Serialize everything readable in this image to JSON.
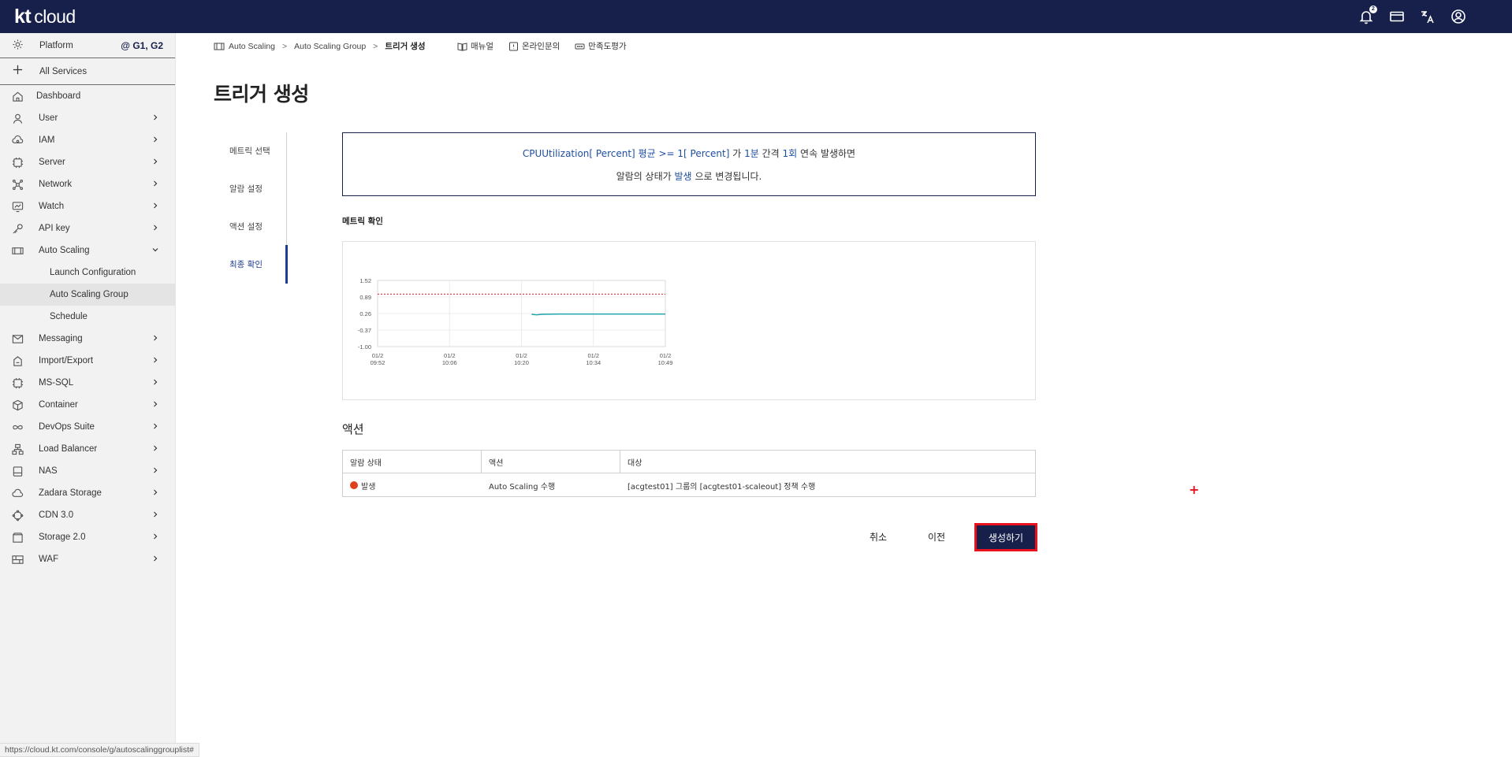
{
  "app": {
    "logo_kt": "kt",
    "logo_cloud": "cloud",
    "notification_count": "2"
  },
  "topbar": {
    "icons": [
      "bell-icon",
      "card-icon",
      "language-icon",
      "user-icon"
    ]
  },
  "sidebar": {
    "platform_label": "Platform",
    "region": "@ G1, G2",
    "all_services": "All Services",
    "dashboard": "Dashboard",
    "items": [
      {
        "label": "User"
      },
      {
        "label": "IAM"
      },
      {
        "label": "Server"
      },
      {
        "label": "Network"
      },
      {
        "label": "Watch"
      },
      {
        "label": "API key"
      },
      {
        "label": "Auto Scaling"
      }
    ],
    "sub_items": [
      {
        "label": "Launch Configuration"
      },
      {
        "label": "Auto Scaling Group"
      },
      {
        "label": "Schedule"
      }
    ],
    "items2": [
      {
        "label": "Messaging"
      },
      {
        "label": "Import/Export"
      },
      {
        "label": "MS-SQL"
      },
      {
        "label": "Container"
      },
      {
        "label": "DevOps Suite"
      },
      {
        "label": "Load Balancer"
      },
      {
        "label": "NAS"
      },
      {
        "label": "Zadara Storage"
      },
      {
        "label": "CDN 3.0"
      },
      {
        "label": "Storage 2.0"
      },
      {
        "label": "WAF"
      }
    ]
  },
  "statusbar": {
    "url": "https://cloud.kt.com/console/g/autoscalinggrouplist#"
  },
  "breadcrumb": {
    "item1": "Auto Scaling",
    "item2": "Auto Scaling Group",
    "current": "트리거 생성",
    "sep": ">"
  },
  "links": {
    "manual": "매뉴얼",
    "inquiry": "온라인문의",
    "survey": "만족도평가"
  },
  "page": {
    "title": "트리거 생성"
  },
  "steps": [
    "메트릭 선택",
    "알람 설정",
    "액션 설정",
    "최종 확인"
  ],
  "summary": {
    "metric": "CPUUtilization[ Percent]",
    "stat": "평균",
    "operator": ">=",
    "threshold": "1[ Percent]",
    "ga": "가",
    "period": "1분",
    "interval_word": "간격",
    "count": "1회",
    "tail": "연속 발생하면",
    "l2_a": "알람의 상태가",
    "state": "발생",
    "l2_b": "으로 변경됩니다."
  },
  "metric_check": {
    "label": "메트릭 확인"
  },
  "chart_data": {
    "type": "line",
    "yticks": [
      "1.52",
      "0.89",
      "0.26",
      "-0.37",
      "-1.00"
    ],
    "ylim": [
      -1.0,
      1.52
    ],
    "xticks": [
      {
        "date": "01/2",
        "time": "09:52"
      },
      {
        "date": "01/2",
        "time": "10:06"
      },
      {
        "date": "01/2",
        "time": "10:20"
      },
      {
        "date": "01/2",
        "time": "10:34"
      },
      {
        "date": "01/2",
        "time": "10:49"
      }
    ],
    "threshold": 1,
    "threshold_color": "#e8111d",
    "series_color": "#1aa3a8",
    "series": [
      {
        "x": 30.5,
        "y": 0.23
      },
      {
        "x": 31.5,
        "y": 0.21
      },
      {
        "x": 32.5,
        "y": 0.23
      },
      {
        "x": 36,
        "y": 0.24
      },
      {
        "x": 57,
        "y": 0.24
      }
    ],
    "xrange": [
      0,
      57
    ],
    "grid": true
  },
  "action": {
    "title": "액션",
    "headers": [
      "알람 상태",
      "액션",
      "대상"
    ],
    "row": {
      "state": "발생",
      "action": "Auto Scaling 수행",
      "target": "[acgtest01] 그룹의 [acgtest01-scaleout] 정책 수행"
    }
  },
  "buttons": {
    "cancel": "취소",
    "prev": "이전",
    "create": "생성하기"
  },
  "colors": {
    "nav": "#16204a",
    "accent": "#1d4ea0",
    "alert": "#e0401c",
    "highlight_border": "#e8111d"
  }
}
